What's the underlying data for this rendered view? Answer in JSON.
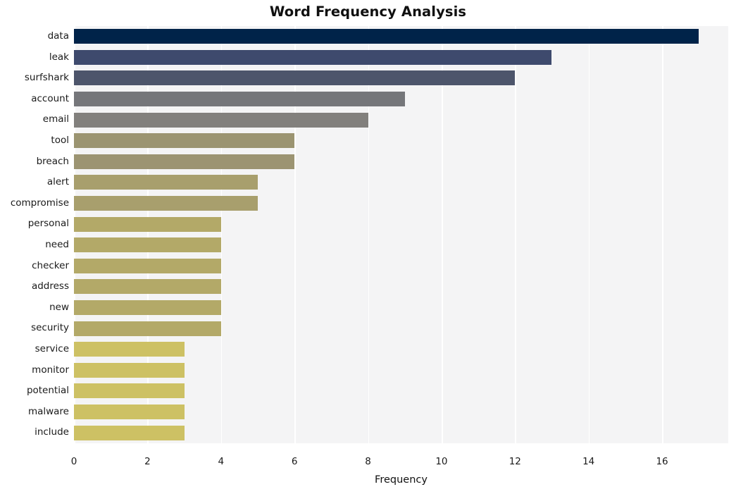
{
  "chart_data": {
    "type": "bar",
    "orientation": "horizontal",
    "title": "Word Frequency Analysis",
    "xlabel": "Frequency",
    "ylabel": "",
    "categories": [
      "data",
      "leak",
      "surfshark",
      "account",
      "email",
      "tool",
      "breach",
      "alert",
      "compromise",
      "personal",
      "need",
      "checker",
      "address",
      "new",
      "security",
      "service",
      "monitor",
      "potential",
      "malware",
      "include"
    ],
    "values": [
      17,
      13,
      12,
      9,
      8,
      6,
      6,
      5,
      5,
      4,
      4,
      4,
      4,
      4,
      4,
      3,
      3,
      3,
      3,
      3
    ],
    "bar_colors": [
      "#002349",
      "#3e4a6d",
      "#4d556b",
      "#75767a",
      "#82807d",
      "#9b9471",
      "#9c9472",
      "#a89f6d",
      "#a89f6d",
      "#b3a968",
      "#b3a968",
      "#b3a968",
      "#b3a968",
      "#b3a968",
      "#b3a968",
      "#cdc164",
      "#cdc164",
      "#cdc164",
      "#cdc164",
      "#cdc164"
    ],
    "xlim": [
      0,
      17.8
    ],
    "xticks": [
      0,
      2,
      4,
      6,
      8,
      10,
      12,
      14,
      16
    ],
    "xtick_labels": [
      "0",
      "2",
      "4",
      "6",
      "8",
      "10",
      "12",
      "14",
      "16"
    ],
    "grid": true,
    "grid_color": "#ffffff",
    "plot_background": "#f4f4f5",
    "figure_background": "#ffffff",
    "legend": null
  }
}
